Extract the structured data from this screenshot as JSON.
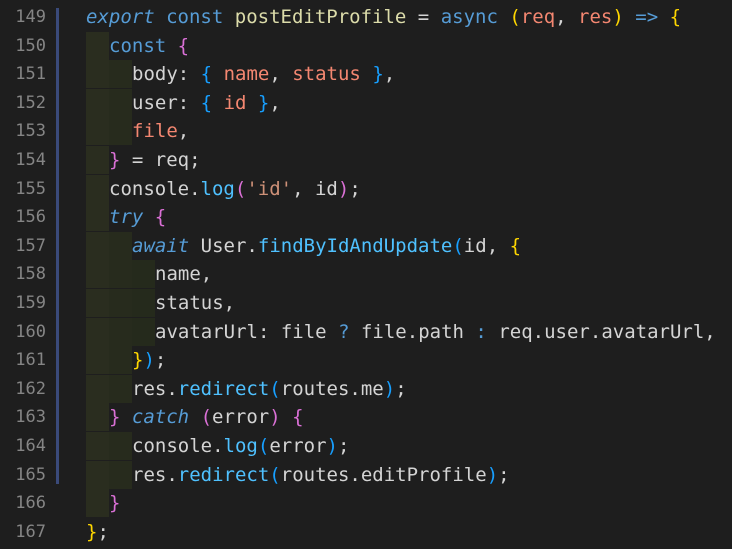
{
  "editor": {
    "lines": [
      {
        "num": "149",
        "tokens": [
          {
            "t": "export",
            "c": "kw-i"
          },
          {
            "t": " ",
            "c": "plain"
          },
          {
            "t": "const",
            "c": "kw"
          },
          {
            "t": " ",
            "c": "plain"
          },
          {
            "t": "postEditProfile",
            "c": "fn"
          },
          {
            "t": " ",
            "c": "plain"
          },
          {
            "t": "=",
            "c": "plain"
          },
          {
            "t": " ",
            "c": "plain"
          },
          {
            "t": "async",
            "c": "kw"
          },
          {
            "t": " ",
            "c": "plain"
          },
          {
            "t": "(",
            "c": "brk1"
          },
          {
            "t": "req",
            "c": "prop"
          },
          {
            "t": ", ",
            "c": "plain"
          },
          {
            "t": "res",
            "c": "prop"
          },
          {
            "t": ")",
            "c": "brk1"
          },
          {
            "t": " ",
            "c": "plain"
          },
          {
            "t": "=>",
            "c": "kw"
          },
          {
            "t": " ",
            "c": "plain"
          },
          {
            "t": "{",
            "c": "brk1"
          }
        ]
      },
      {
        "num": "150",
        "indent": 1,
        "tokens": [
          {
            "t": "const",
            "c": "kw"
          },
          {
            "t": " ",
            "c": "plain"
          },
          {
            "t": "{",
            "c": "brk2"
          }
        ]
      },
      {
        "num": "151",
        "indent": 2,
        "tokens": [
          {
            "t": "body",
            "c": "plain"
          },
          {
            "t": ": ",
            "c": "plain"
          },
          {
            "t": "{",
            "c": "brk3"
          },
          {
            "t": " ",
            "c": "plain"
          },
          {
            "t": "name",
            "c": "prop"
          },
          {
            "t": ", ",
            "c": "plain"
          },
          {
            "t": "status",
            "c": "prop"
          },
          {
            "t": " ",
            "c": "plain"
          },
          {
            "t": "}",
            "c": "brk3"
          },
          {
            "t": ",",
            "c": "plain"
          }
        ]
      },
      {
        "num": "152",
        "indent": 2,
        "tokens": [
          {
            "t": "user",
            "c": "plain"
          },
          {
            "t": ": ",
            "c": "plain"
          },
          {
            "t": "{",
            "c": "brk3"
          },
          {
            "t": " ",
            "c": "plain"
          },
          {
            "t": "id",
            "c": "prop"
          },
          {
            "t": " ",
            "c": "plain"
          },
          {
            "t": "}",
            "c": "brk3"
          },
          {
            "t": ",",
            "c": "plain"
          }
        ]
      },
      {
        "num": "153",
        "indent": 2,
        "tokens": [
          {
            "t": "file",
            "c": "prop"
          },
          {
            "t": ",",
            "c": "plain"
          }
        ]
      },
      {
        "num": "154",
        "indent": 1,
        "tokens": [
          {
            "t": "}",
            "c": "brk2"
          },
          {
            "t": " = ",
            "c": "plain"
          },
          {
            "t": "req",
            "c": "plain"
          },
          {
            "t": ";",
            "c": "plain"
          }
        ]
      },
      {
        "num": "155",
        "indent": 1,
        "tokens": [
          {
            "t": "console",
            "c": "plain"
          },
          {
            "t": ".",
            "c": "plain"
          },
          {
            "t": "log",
            "c": "meth"
          },
          {
            "t": "(",
            "c": "brk2"
          },
          {
            "t": "'id'",
            "c": "str"
          },
          {
            "t": ", ",
            "c": "plain"
          },
          {
            "t": "id",
            "c": "plain"
          },
          {
            "t": ")",
            "c": "brk2"
          },
          {
            "t": ";",
            "c": "plain"
          }
        ]
      },
      {
        "num": "156",
        "indent": 1,
        "tokens": [
          {
            "t": "try",
            "c": "kw-i"
          },
          {
            "t": " ",
            "c": "plain"
          },
          {
            "t": "{",
            "c": "brk2"
          }
        ]
      },
      {
        "num": "157",
        "indent": 2,
        "tokens": [
          {
            "t": "await",
            "c": "kw-i"
          },
          {
            "t": " ",
            "c": "plain"
          },
          {
            "t": "User",
            "c": "plain"
          },
          {
            "t": ".",
            "c": "plain"
          },
          {
            "t": "findByIdAndUpdate",
            "c": "meth"
          },
          {
            "t": "(",
            "c": "brk3"
          },
          {
            "t": "id",
            "c": "plain"
          },
          {
            "t": ", ",
            "c": "plain"
          },
          {
            "t": "{",
            "c": "brk1"
          }
        ]
      },
      {
        "num": "158",
        "indent": 3,
        "tokens": [
          {
            "t": "name",
            "c": "plain"
          },
          {
            "t": ",",
            "c": "plain"
          }
        ]
      },
      {
        "num": "159",
        "indent": 3,
        "tokens": [
          {
            "t": "status",
            "c": "plain"
          },
          {
            "t": ",",
            "c": "plain"
          }
        ]
      },
      {
        "num": "160",
        "indent": 3,
        "tokens": [
          {
            "t": "avatarUrl",
            "c": "plain"
          },
          {
            "t": ": ",
            "c": "plain"
          },
          {
            "t": "file",
            "c": "plain"
          },
          {
            "t": " ",
            "c": "plain"
          },
          {
            "t": "?",
            "c": "kw"
          },
          {
            "t": " ",
            "c": "plain"
          },
          {
            "t": "file",
            "c": "plain"
          },
          {
            "t": ".",
            "c": "plain"
          },
          {
            "t": "path",
            "c": "plain"
          },
          {
            "t": " ",
            "c": "plain"
          },
          {
            "t": ":",
            "c": "kw"
          },
          {
            "t": " ",
            "c": "plain"
          },
          {
            "t": "req",
            "c": "plain"
          },
          {
            "t": ".",
            "c": "plain"
          },
          {
            "t": "user",
            "c": "plain"
          },
          {
            "t": ".",
            "c": "plain"
          },
          {
            "t": "avatarUrl",
            "c": "plain"
          },
          {
            "t": ",",
            "c": "plain"
          }
        ]
      },
      {
        "num": "161",
        "indent": 2,
        "tokens": [
          {
            "t": "}",
            "c": "brk1"
          },
          {
            "t": ")",
            "c": "brk3"
          },
          {
            "t": ";",
            "c": "plain"
          }
        ]
      },
      {
        "num": "162",
        "indent": 2,
        "tokens": [
          {
            "t": "res",
            "c": "plain"
          },
          {
            "t": ".",
            "c": "plain"
          },
          {
            "t": "redirect",
            "c": "meth"
          },
          {
            "t": "(",
            "c": "brk3"
          },
          {
            "t": "routes",
            "c": "plain"
          },
          {
            "t": ".",
            "c": "plain"
          },
          {
            "t": "me",
            "c": "plain"
          },
          {
            "t": ")",
            "c": "brk3"
          },
          {
            "t": ";",
            "c": "plain"
          }
        ]
      },
      {
        "num": "163",
        "indent": 1,
        "tokens": [
          {
            "t": "}",
            "c": "brk2"
          },
          {
            "t": " ",
            "c": "plain"
          },
          {
            "t": "catch",
            "c": "kw-i"
          },
          {
            "t": " ",
            "c": "plain"
          },
          {
            "t": "(",
            "c": "brk2"
          },
          {
            "t": "error",
            "c": "plain"
          },
          {
            "t": ")",
            "c": "brk2"
          },
          {
            "t": " ",
            "c": "plain"
          },
          {
            "t": "{",
            "c": "brk2"
          }
        ]
      },
      {
        "num": "164",
        "indent": 2,
        "tokens": [
          {
            "t": "console",
            "c": "plain"
          },
          {
            "t": ".",
            "c": "plain"
          },
          {
            "t": "log",
            "c": "meth"
          },
          {
            "t": "(",
            "c": "brk3"
          },
          {
            "t": "error",
            "c": "plain"
          },
          {
            "t": ")",
            "c": "brk3"
          },
          {
            "t": ";",
            "c": "plain"
          }
        ]
      },
      {
        "num": "165",
        "indent": 2,
        "tokens": [
          {
            "t": "res",
            "c": "plain"
          },
          {
            "t": ".",
            "c": "plain"
          },
          {
            "t": "redirect",
            "c": "meth"
          },
          {
            "t": "(",
            "c": "brk3"
          },
          {
            "t": "routes",
            "c": "plain"
          },
          {
            "t": ".",
            "c": "plain"
          },
          {
            "t": "editProfile",
            "c": "plain"
          },
          {
            "t": ")",
            "c": "brk3"
          },
          {
            "t": ";",
            "c": "plain"
          }
        ]
      },
      {
        "num": "166",
        "indent": 1,
        "tokens": [
          {
            "t": "}",
            "c": "brk2"
          }
        ]
      },
      {
        "num": "167",
        "tokens": [
          {
            "t": "}",
            "c": "brk1"
          },
          {
            "t": ";",
            "c": "plain"
          }
        ]
      }
    ]
  }
}
